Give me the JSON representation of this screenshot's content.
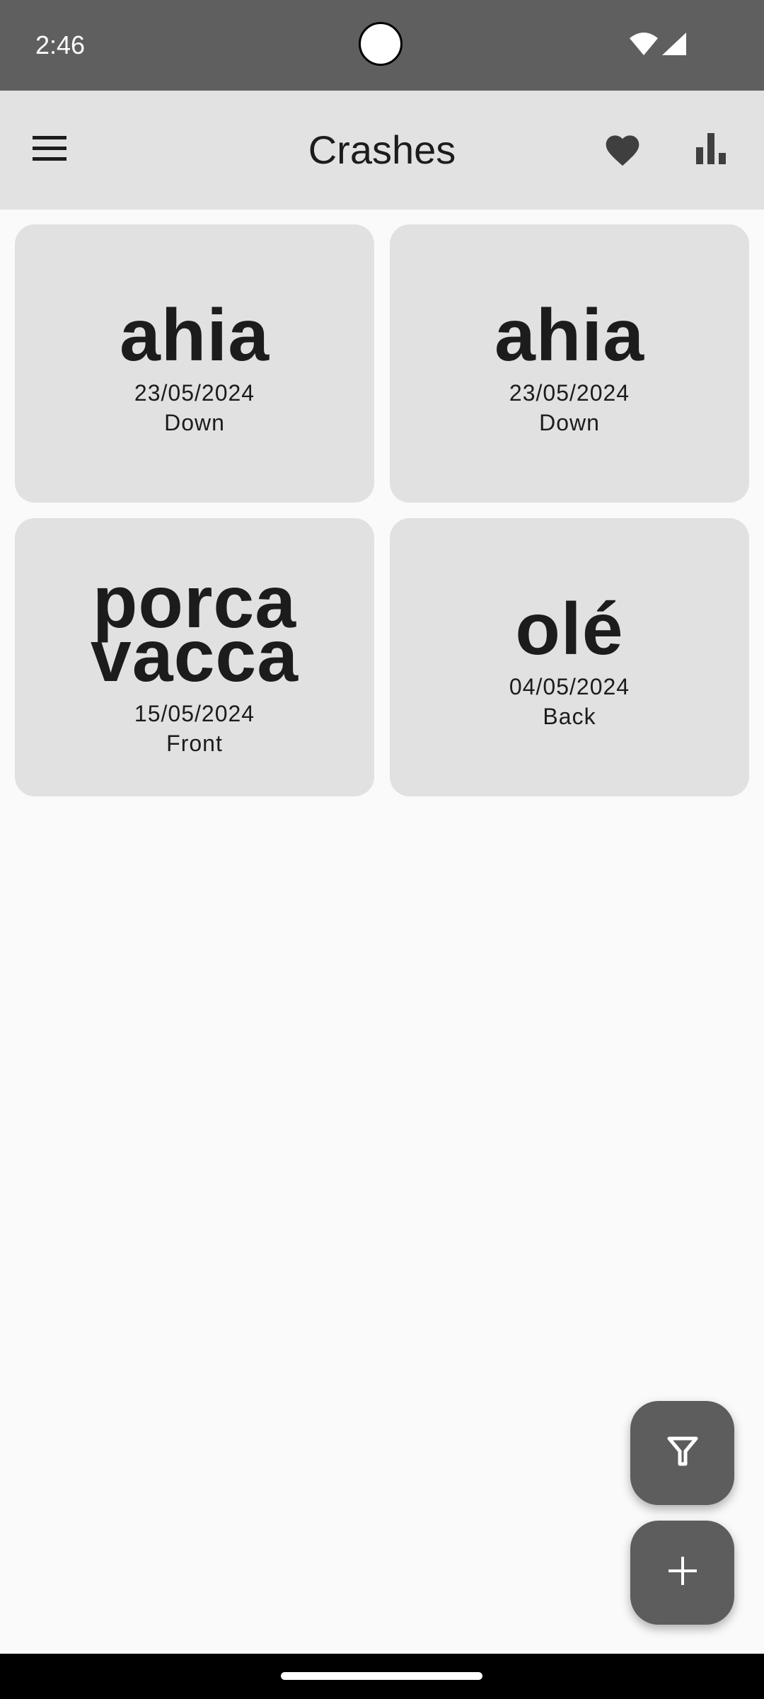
{
  "status_bar": {
    "time": "2:46",
    "icons": [
      "wifi-icon",
      "cellular-signal-icon"
    ],
    "background": "#5f5f5f"
  },
  "app_bar": {
    "title": "Crashes",
    "menu_icon": "hamburger-menu-icon",
    "favorites_icon": "heart-icon",
    "stats_icon": "bar-chart-icon",
    "background": "#e2e2e2"
  },
  "cards": [
    {
      "title": "ahia",
      "date": "23/05/2024",
      "position": "Down"
    },
    {
      "title": "ahia",
      "date": "23/05/2024",
      "position": "Down"
    },
    {
      "title": "porca vacca",
      "date": "15/05/2024",
      "position": "Front"
    },
    {
      "title": "olé",
      "date": "04/05/2024",
      "position": "Back"
    }
  ],
  "fabs": {
    "filter_icon": "filter-icon",
    "add_icon": "plus-icon",
    "color": "#5d5d5d"
  }
}
